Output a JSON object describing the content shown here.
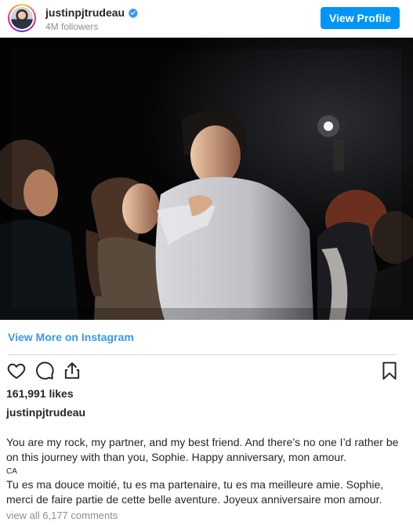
{
  "header": {
    "username": "justinpjtrudeau",
    "followers": "4M followers",
    "view_profile_label": "View Profile",
    "verified_color": "#3897f0"
  },
  "post": {
    "photo_alt": "Couple dancing at night event"
  },
  "links": {
    "view_more": "View More on Instagram",
    "view_all_comments": "view all 6,177 comments"
  },
  "actions": {
    "icons": [
      "heart-icon",
      "comment-icon",
      "share-icon",
      "bookmark-icon"
    ]
  },
  "stats": {
    "likes": "161,991 likes"
  },
  "caption": {
    "username": "justinpjtrudeau",
    "text_en": "You are my rock, my partner, and my best friend. And there’s no one I’d rather be on this journey with than you, Sophie. Happy anniversary, mon amour.",
    "lang_tag": "CA",
    "text_fr": "Tu es ma douce moitié, tu es ma partenaire, tu es ma meilleure amie. Sophie, merci de faire partie de cette belle aventure. Joyeux anniversaire mon amour."
  },
  "colors": {
    "accent": "#0095f6",
    "link": "#3897f0",
    "muted": "#8e8e8e",
    "text": "#262626"
  }
}
